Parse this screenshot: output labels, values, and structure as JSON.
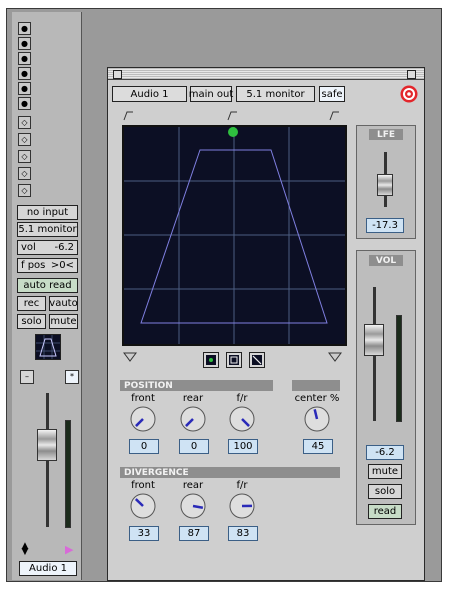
{
  "strip": {
    "io_selectors": [
      "no input",
      "5.1 monitor"
    ],
    "vol_label": "vol",
    "vol_value": "-6.2",
    "fpos_label": "f pos",
    "fpos_value": ">0<",
    "automation": "auto read",
    "rec": "rec",
    "vauto": "vauto",
    "solo": "solo",
    "mute": "mute",
    "track_name": "Audio 1"
  },
  "panel": {
    "track_button": "Audio 1",
    "output_button": "main out",
    "path_button": "5.1 monitor",
    "safe_button": "safe",
    "position": {
      "header": "POSITION",
      "front": {
        "label": "front",
        "value": "0"
      },
      "rear": {
        "label": "rear",
        "value": "0"
      },
      "fr": {
        "label": "f/r",
        "value": "100"
      }
    },
    "center": {
      "header": "center %",
      "value": "45"
    },
    "divergence": {
      "header": "DIVERGENCE",
      "front": {
        "label": "front",
        "value": "33"
      },
      "rear": {
        "label": "rear",
        "value": "87"
      },
      "fr": {
        "label": "f/r",
        "value": "83"
      }
    },
    "lfe": {
      "header": "LFE",
      "value": "-17.3"
    },
    "vol": {
      "header": "VOL",
      "value": "-6.2",
      "mute": "mute",
      "solo": "solo",
      "read": "read"
    }
  },
  "colors": {
    "grid_background": "#0c0f24",
    "grid_lines": "#4c5d82",
    "pan_shape": "#7f7fe0",
    "pan_dot": "#2fbf3f",
    "value_box": "#cfe3f4",
    "record_button": "#e3262b"
  }
}
